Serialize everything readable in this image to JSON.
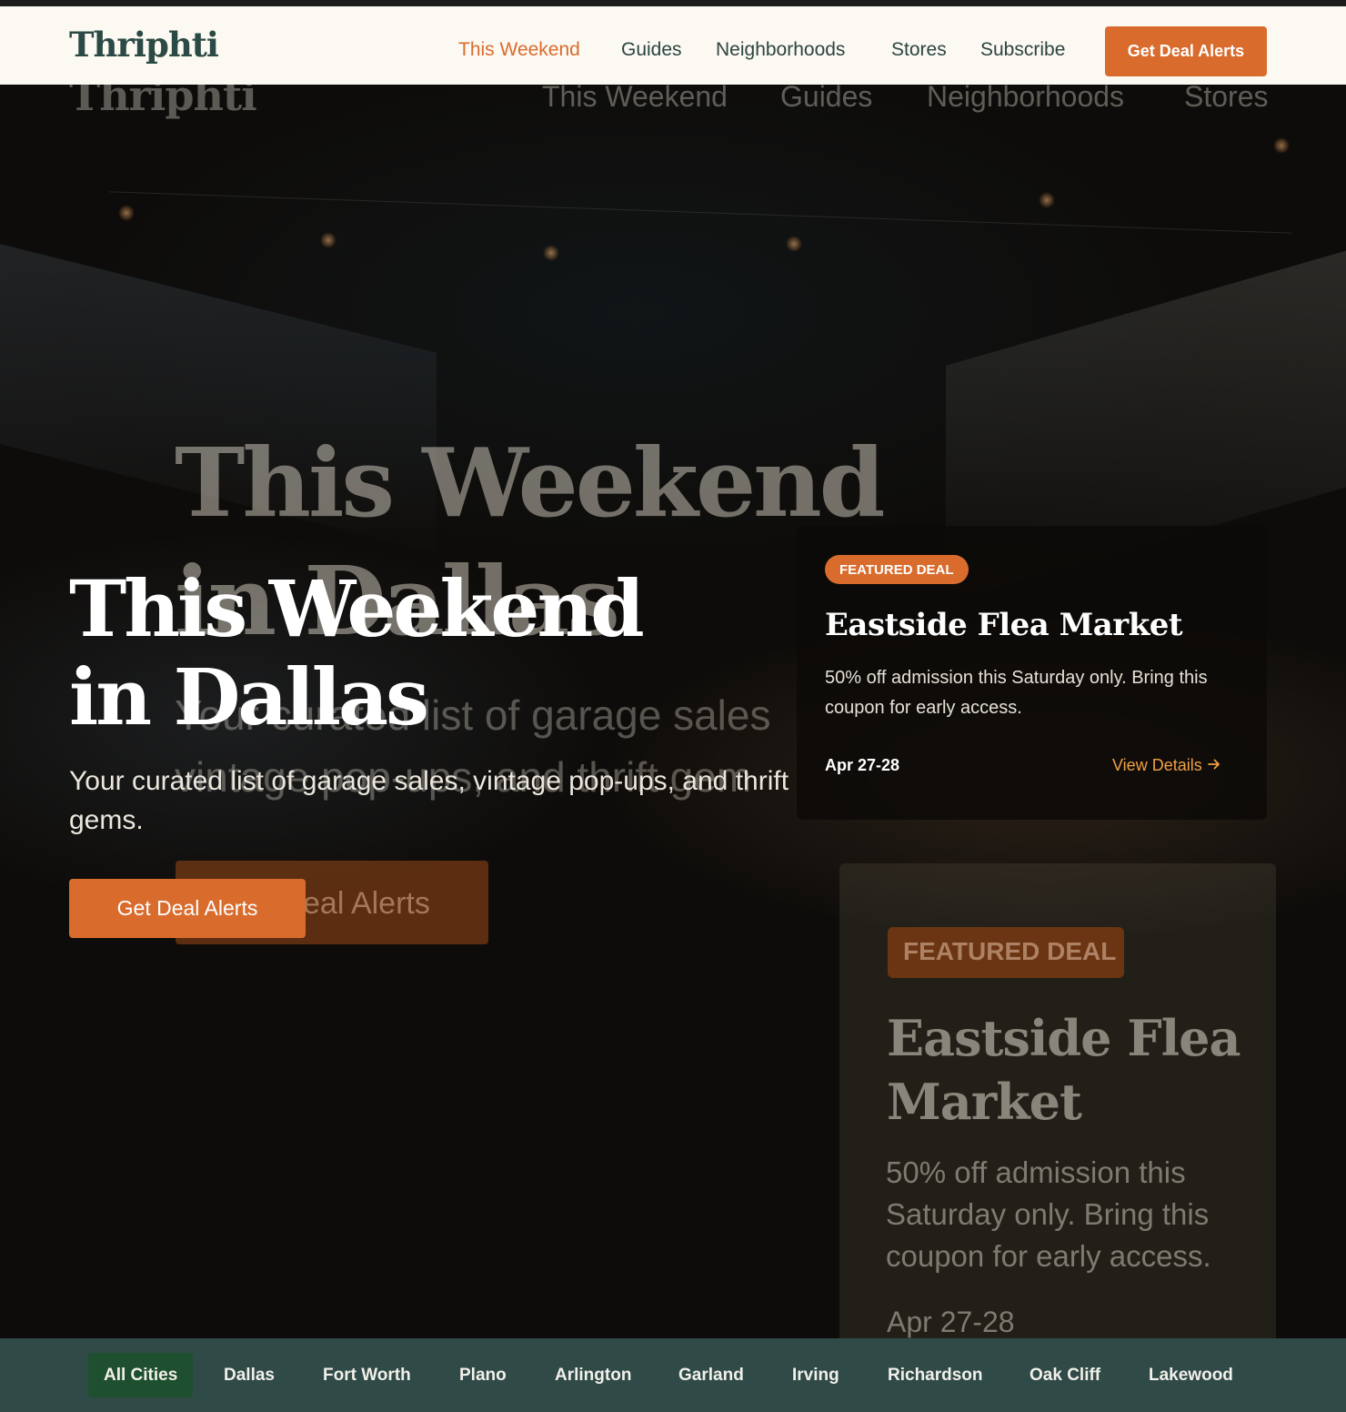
{
  "brand": {
    "name": "Thriphti"
  },
  "nav": {
    "items": [
      {
        "label": "This Weekend",
        "active": true
      },
      {
        "label": "Guides"
      },
      {
        "label": "Neighborhoods"
      },
      {
        "label": "Stores"
      },
      {
        "label": "Subscribe"
      }
    ],
    "cta_label": "Get Deal Alerts"
  },
  "hero": {
    "title_line1": "This Weekend",
    "title_line2": "in Dallas",
    "subtitle": "Your curated list of garage sales, vintage pop-ups, and thrift gems.",
    "cta_label": "Get Deal Alerts"
  },
  "ghost": {
    "nav": [
      "This Weekend",
      "Guides",
      "Neighborhoods",
      "Stores"
    ],
    "title_line1": "This Weekend",
    "title_line2": "in Dallas",
    "subtitle_line1": "Your curated list of garage sales",
    "subtitle_line2": "vintage pop-ups, and thrift gem",
    "cta_label": "eal Alerts",
    "badge": "FEATURED DEAL",
    "card_title": "Eastside Flea Market",
    "card_desc": "50% off admission this Saturday only. Bring this coupon for early access.",
    "card_date": "Apr 27-28"
  },
  "featured": {
    "badge": "FEATURED DEAL",
    "title": "Eastside Flea Market",
    "description": "50% off admission this Saturday only. Bring this coupon for early access.",
    "date": "Apr 27-28",
    "link_label": "View Details",
    "link_icon": "arrow-right-icon"
  },
  "cities": [
    {
      "label": "All Cities",
      "active": true
    },
    {
      "label": "Dallas"
    },
    {
      "label": "Fort Worth"
    },
    {
      "label": "Plano"
    },
    {
      "label": "Arlington"
    },
    {
      "label": "Garland"
    },
    {
      "label": "Irving"
    },
    {
      "label": "Richardson"
    },
    {
      "label": "Oak Cliff"
    },
    {
      "label": "Lakewood"
    }
  ],
  "colors": {
    "accent": "#d96c2d",
    "brand_dark": "#2c4a45",
    "header_bg": "#fcf8f2",
    "citybar_bg": "#2f4a47",
    "chip_active": "#1e4f2e",
    "link": "#f0a045"
  }
}
